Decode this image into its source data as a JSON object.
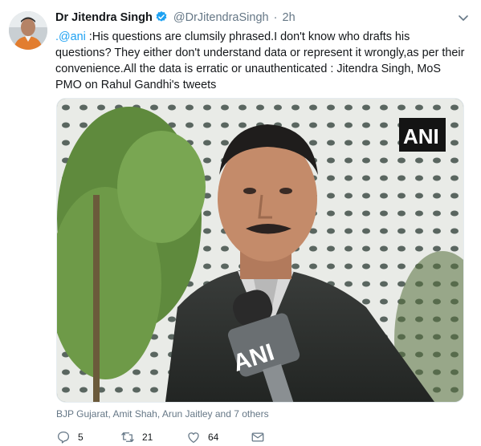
{
  "tweet": {
    "name": "Dr Jitendra Singh",
    "handle": "@DrJitendraSingh",
    "dot": "·",
    "time": "2h",
    "mention": ".@ani",
    "text": " :His questions are clumsily phrased.I don't know who drafts his questions? They either don't understand data or represent it wrongly,as per their convenience.All the data is erratic or unauthenticated : Jitendra Singh, MoS PMO on Rahul Gandhi's tweets",
    "media_watermark": "ANI",
    "mic_label": "ANI",
    "tagged": "BJP Gujarat, Amit Shah, Arun Jaitley and 7 others",
    "replies": "5",
    "retweets": "21",
    "likes": "64"
  },
  "colors": {
    "link": "#1da1f2",
    "muted": "#657786",
    "text": "#14171a"
  },
  "icons": {
    "verified": "verified-badge-icon",
    "chevron": "chevron-down-icon",
    "reply": "reply-icon",
    "retweet": "retweet-icon",
    "like": "heart-icon",
    "dm": "envelope-icon"
  }
}
